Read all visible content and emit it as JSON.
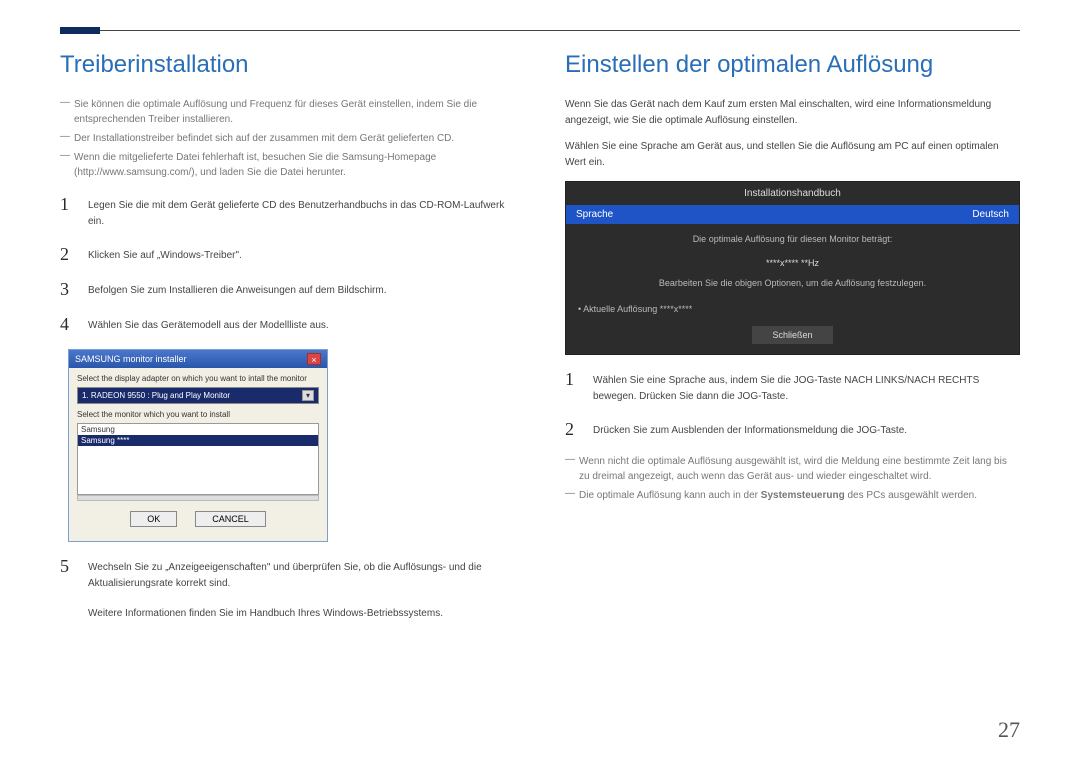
{
  "page_number": "27",
  "left": {
    "heading": "Treiberinstallation",
    "notes": [
      "Sie können die optimale Auflösung und Frequenz für dieses Gerät einstellen, indem Sie die entsprechenden Treiber installieren.",
      "Der Installationstreiber befindet sich auf der zusammen mit dem Gerät gelieferten CD.",
      "Wenn die mitgelieferte Datei fehlerhaft ist, besuchen Sie die Samsung-Homepage (http://www.samsung.com/), und laden Sie die Datei herunter."
    ],
    "steps": [
      {
        "n": "1",
        "t": "Legen Sie die mit dem Gerät gelieferte CD des Benutzerhandbuchs in das CD-ROM-Laufwerk ein."
      },
      {
        "n": "2",
        "t": "Klicken Sie auf „Windows-Treiber\"."
      },
      {
        "n": "3",
        "t": "Befolgen Sie zum Installieren die Anweisungen auf dem Bildschirm."
      },
      {
        "n": "4",
        "t": "Wählen Sie das Gerätemodell aus der Modellliste aus."
      }
    ],
    "installer": {
      "title": "SAMSUNG monitor installer",
      "label1": "Select the display adapter on which you want to intall the monitor",
      "dropdown": "1. RADEON 9550 : Plug and Play Monitor",
      "label2": "Select the monitor which you want to install",
      "list_row1": "Samsung",
      "list_row_sel": "Samsung ****",
      "ok": "OK",
      "cancel": "CANCEL"
    },
    "step5": {
      "n": "5",
      "t": "Wechseln Sie zu „Anzeigeeigenschaften\" und überprüfen Sie, ob die Auflösungs- und die Aktualisierungsrate korrekt sind."
    },
    "footer": "Weitere Informationen finden Sie im Handbuch Ihres Windows-Betriebssystems."
  },
  "right": {
    "heading": "Einstellen der optimalen Auflösung",
    "intro1": "Wenn Sie das Gerät nach dem Kauf zum ersten Mal einschalten, wird eine Informationsmeldung angezeigt, wie Sie die optimale Auflösung einstellen.",
    "intro2": "Wählen Sie eine Sprache am Gerät aus, und stellen Sie die Auflösung am PC auf einen optimalen Wert ein.",
    "osd": {
      "title": "Installationshandbuch",
      "lang_label": "Sprache",
      "lang_value": "Deutsch",
      "line1": "Die optimale Auflösung für diesen Monitor beträgt:",
      "res": "****x**** **Hz",
      "line2": "Bearbeiten Sie die obigen Optionen, um die Auflösung festzulegen.",
      "current": "•  Aktuelle Auflösung    ****x****",
      "close": "Schließen"
    },
    "steps": [
      {
        "n": "1",
        "t": "Wählen Sie eine Sprache aus, indem Sie die JOG-Taste NACH LINKS/NACH RECHTS bewegen. Drücken Sie dann die JOG-Taste."
      },
      {
        "n": "2",
        "t": "Drücken Sie zum Ausblenden der Informationsmeldung die JOG-Taste."
      }
    ],
    "notes": [
      "Wenn nicht die optimale Auflösung ausgewählt ist, wird die Meldung eine bestimmte Zeit lang bis zu dreimal angezeigt, auch wenn das Gerät aus- und wieder eingeschaltet wird.",
      "Die optimale Auflösung kann auch in der <b>Systemsteuerung</b> des PCs ausgewählt werden."
    ]
  }
}
